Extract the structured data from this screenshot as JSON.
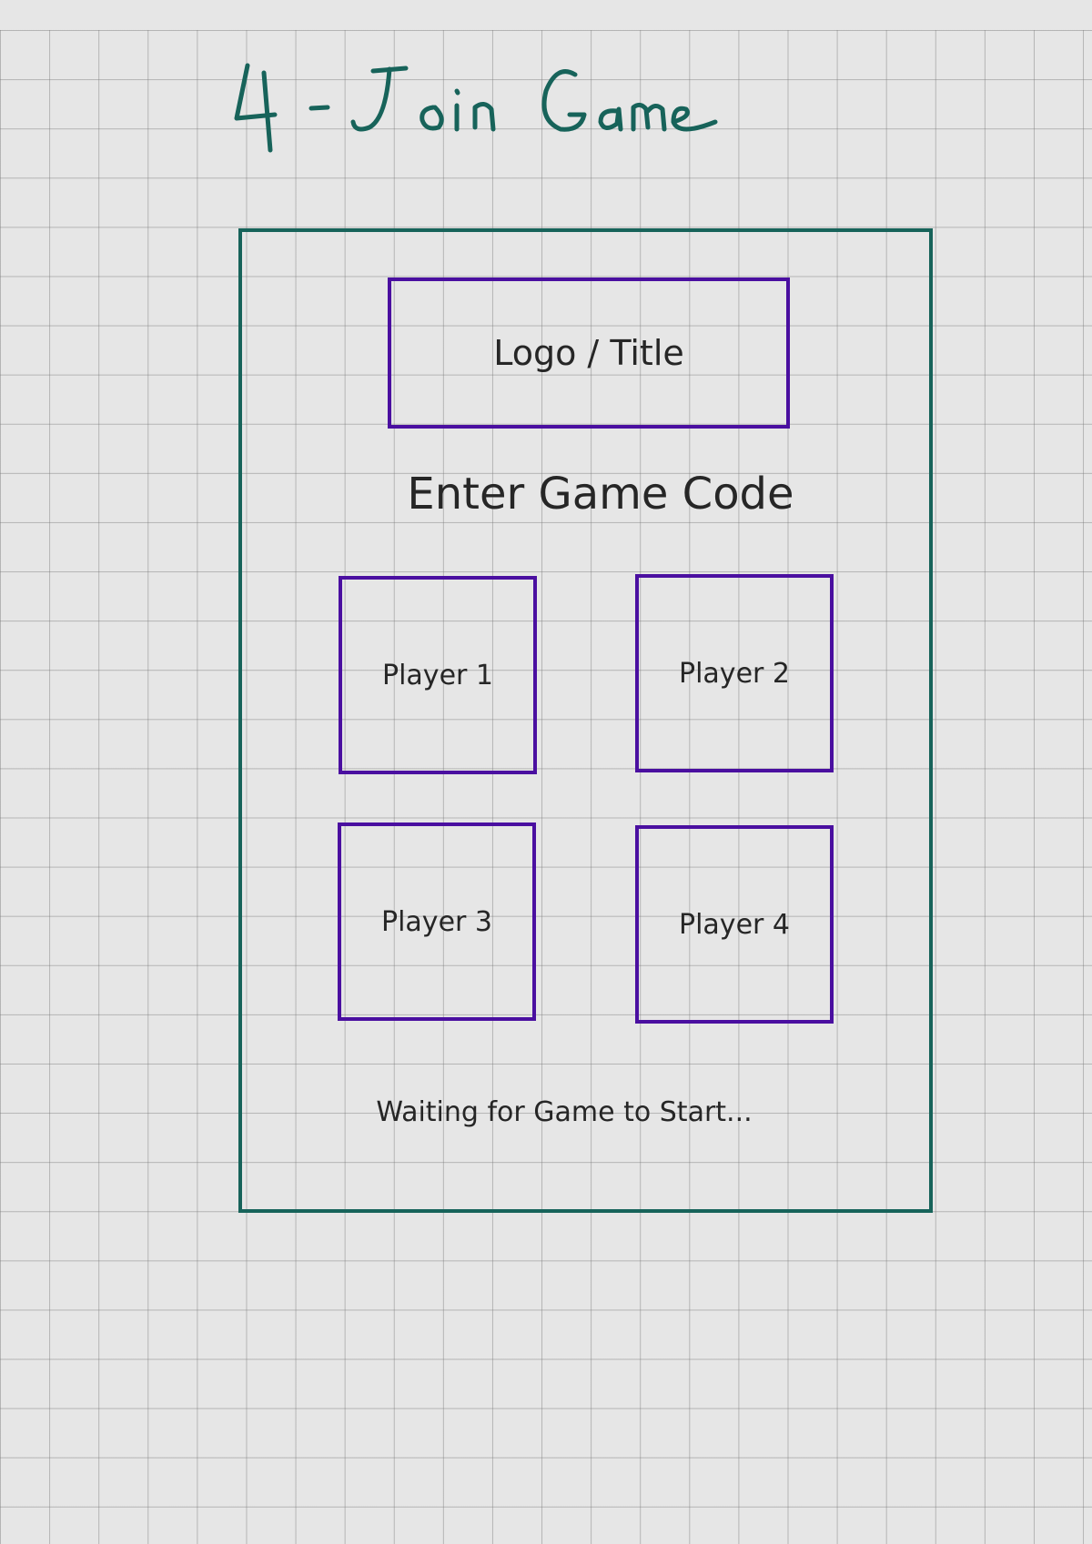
{
  "sketch": {
    "heading": "4 - Join Game",
    "heading_color": "#17635a"
  },
  "screen": {
    "frame_color": "#17635a",
    "box_color": "#4a0fa0",
    "logo_label": "Logo / Title",
    "code_label": "Enter Game Code",
    "players": [
      {
        "label": "Player 1"
      },
      {
        "label": "Player 2"
      },
      {
        "label": "Player 3"
      },
      {
        "label": "Player 4"
      }
    ],
    "status": "Waiting for Game to Start..."
  }
}
